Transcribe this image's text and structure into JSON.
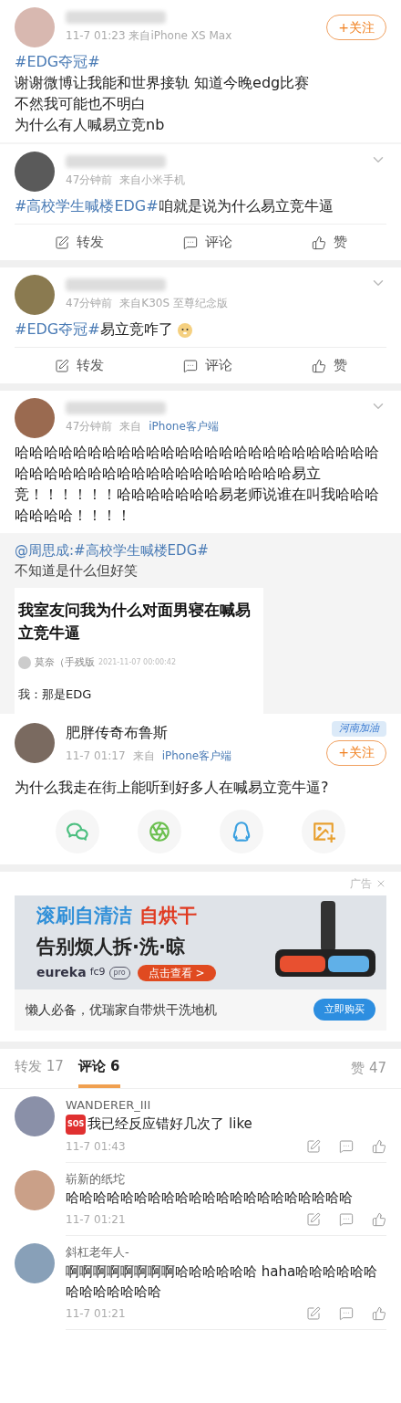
{
  "posts": [
    {
      "menu": false,
      "follow": "+关注",
      "meta": [
        {
          "text": "11-7 01:23 来自iPhone XS Max",
          "kind": "plain"
        }
      ],
      "lines": [
        [
          {
            "text": "#EDG夺冠#",
            "kind": "topic"
          }
        ],
        [
          {
            "text": "谢谢微博让我能和世界接轨 知道今晚edg比赛",
            "kind": "plain"
          }
        ],
        [
          {
            "text": "不然我可能也不明白",
            "kind": "plain"
          }
        ],
        [
          {
            "text": "为什么有人喊易立竞nb",
            "kind": "plain"
          }
        ]
      ],
      "emoji": false
    },
    {
      "menu": true,
      "meta": [
        {
          "text": "47分钟前",
          "kind": "plain"
        },
        {
          "text": "来自小米手机",
          "kind": "plain"
        }
      ],
      "lines": [
        [
          {
            "text": "#高校学生喊楼EDG#",
            "kind": "topic"
          },
          {
            "text": "咱就是说为什么易立竞牛逼",
            "kind": "plain"
          }
        ]
      ],
      "emoji": false,
      "actions": [
        "转发",
        "评论",
        "赞"
      ]
    },
    {
      "menu": true,
      "meta": [
        {
          "text": "47分钟前",
          "kind": "plain"
        },
        {
          "text": "来自K30S 至尊纪念版",
          "kind": "plain"
        }
      ],
      "lines": [
        [
          {
            "text": "#EDG夺冠#",
            "kind": "topic"
          },
          {
            "text": "易立竞咋了",
            "kind": "plain"
          }
        ]
      ],
      "emoji": true,
      "actions": [
        "转发",
        "评论",
        "赞"
      ]
    },
    {
      "menu": true,
      "meta": [
        {
          "text": "47分钟前",
          "kind": "plain"
        },
        {
          "text": "来自",
          "kind": "plain"
        },
        {
          "text": "iPhone客户端",
          "kind": "topic"
        }
      ],
      "lines": [
        [
          {
            "text": "哈哈哈哈哈哈哈哈哈哈哈哈哈哈哈哈哈哈哈哈哈哈哈哈哈哈哈哈哈哈哈哈哈哈哈哈哈哈哈哈哈哈哈哈易立竞！！！！！！哈哈哈哈哈哈哈易老师说谁在叫我哈哈哈哈哈哈哈！！！！",
            "kind": "plain"
          }
        ]
      ],
      "emoji": false
    }
  ],
  "repost": {
    "mention": "@周思成:#高校学生喊楼EDG#",
    "text": "不知道是什么但好笑",
    "card": {
      "title": "我室友问我为什么对面男寝在喊易立竞牛逼",
      "author": "莫奈（手残版",
      "date": "2021-11-07 00:00:42",
      "body": "我：那是EDG"
    }
  },
  "featured_post": {
    "name": "肥胖传奇布鲁斯",
    "badge": "河南加油",
    "follow": "+关注",
    "meta": [
      {
        "text": "11-7 01:17",
        "kind": "plain"
      },
      {
        "text": "来自",
        "kind": "plain"
      },
      {
        "text": "iPhone客户端",
        "kind": "topic"
      }
    ],
    "text": "为什么我走在街上能听到好多人在喊易立竞牛逼?"
  },
  "ad": {
    "label": "广告",
    "banner": {
      "headline_blue": "滚刷自清洁",
      "headline_red": "自烘干",
      "subline": "告别烦人拆·洗·晾",
      "brand": "eureka",
      "model": "fc9",
      "edition": "pro",
      "cta": "点击查看 >"
    },
    "caption": "懒人必备，优瑞家自带烘干洗地机",
    "button": "立即购买"
  },
  "comment_tabs": {
    "tabs": [
      {
        "label": "转发 17",
        "selected": false
      },
      {
        "label": "评论 6",
        "selected": true
      }
    ],
    "likes": "赞 47"
  },
  "comments": [
    {
      "name": "WANDERER_III",
      "emoji": "SOS",
      "text": "我已经反应错好几次了 like",
      "time": "11-7 01:43"
    },
    {
      "name": "崭新的纸坨",
      "text": "哈哈哈哈哈哈哈哈哈哈哈哈哈哈哈哈哈哈哈哈哈",
      "time": "11-7 01:21"
    },
    {
      "name": "斜杠老年人-",
      "text": "啊啊啊啊啊啊啊啊哈哈哈哈哈哈 haha哈哈哈哈哈哈哈哈哈哈哈哈哈",
      "time": "11-7 01:21"
    }
  ]
}
